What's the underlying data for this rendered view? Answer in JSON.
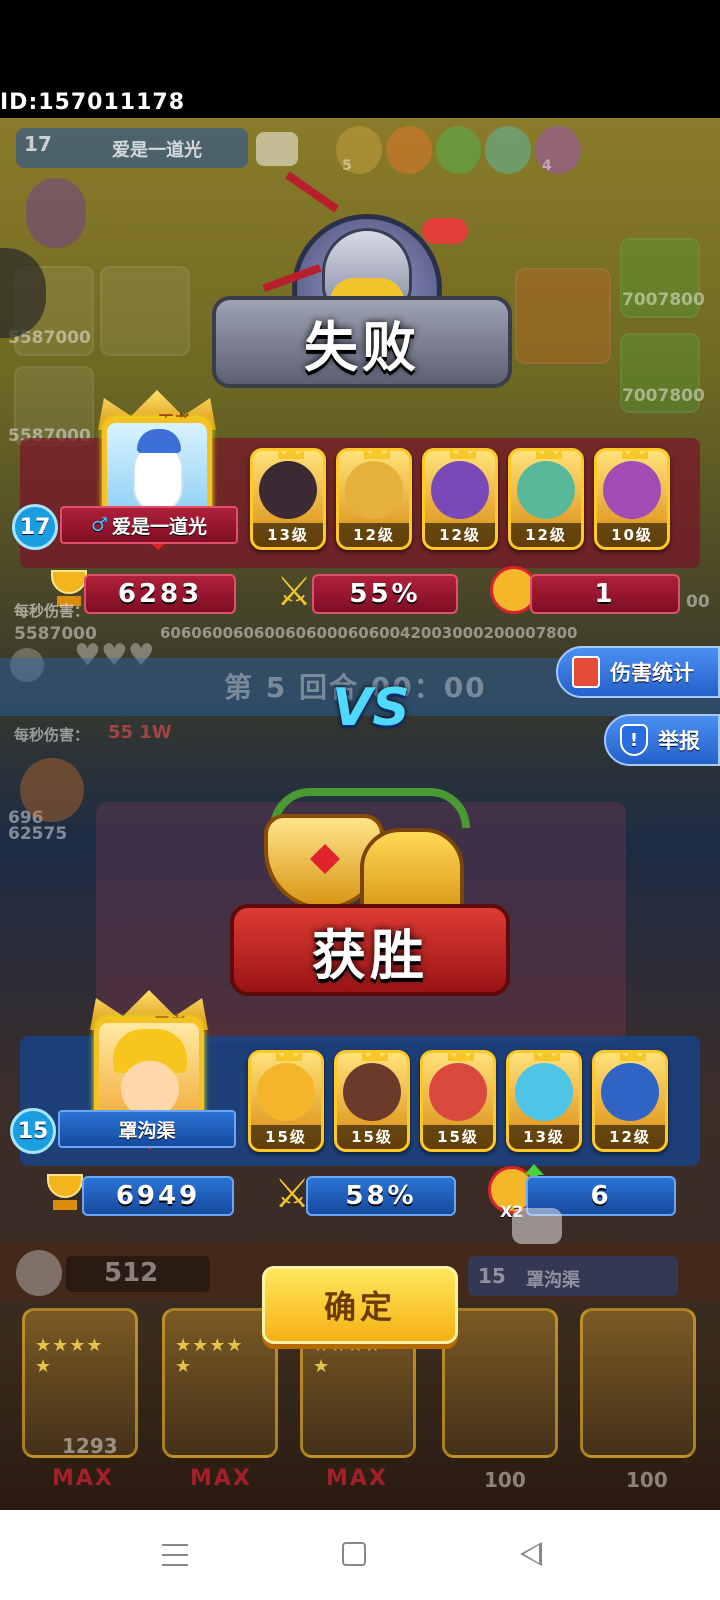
{
  "status": {
    "user_id": "ID:157011178"
  },
  "background": {
    "top_player": {
      "level": "17",
      "name": "爱是一道光",
      "tile_values": [
        "5587000",
        "5587000",
        "7007800",
        "7007800"
      ],
      "hero_stars": [
        "5",
        "4"
      ],
      "dps_label": "每秒伤害：",
      "dps_value": "5587000",
      "damage_row": "6060600606006060006060042003000200007800",
      "right_value": "00"
    },
    "round_text": "第 5 回合 00：00",
    "bottom_player": {
      "dps_label": "每秒伤害：",
      "dps_value": "55 1W",
      "left_value": "696",
      "left_value2": "62575"
    },
    "bottom_bar": {
      "trophy_value": "512",
      "player_level": "15",
      "player_name": "罩沟渠",
      "coin_value": "1293",
      "max_label": "MAX",
      "cost_values": [
        "100",
        "100"
      ]
    }
  },
  "defeat": {
    "title": "失败",
    "player": {
      "level": "17",
      "name": "爱是一道光",
      "badge": "王者"
    },
    "heroes": [
      {
        "level": "13级"
      },
      {
        "level": "12级"
      },
      {
        "level": "12级"
      },
      {
        "level": "12级"
      },
      {
        "level": "10级"
      }
    ],
    "stats": {
      "trophy": "6283",
      "win_rate": "55%",
      "fist": "1"
    }
  },
  "versus": "VS",
  "side_buttons": {
    "damage_stats": "伤害统计",
    "report": "举报"
  },
  "victory": {
    "title": "获胜",
    "player": {
      "level": "15",
      "name": "罩沟渠",
      "badge": "王者"
    },
    "heroes": [
      {
        "level": "15级"
      },
      {
        "level": "15级"
      },
      {
        "level": "15级"
      },
      {
        "level": "13级"
      },
      {
        "level": "12级"
      }
    ],
    "stats": {
      "trophy": "6949",
      "win_rate": "58%",
      "fist": "6",
      "fist_multiplier": "X2"
    }
  },
  "confirm_label": "确定",
  "colors": {
    "defeat": "#b0203a",
    "victory": "#2a73d6",
    "gold": "#f6b116"
  },
  "nav": {
    "menu_icon": "menu-icon",
    "home_icon": "home-square-icon",
    "back_icon": "back-triangle-icon"
  }
}
